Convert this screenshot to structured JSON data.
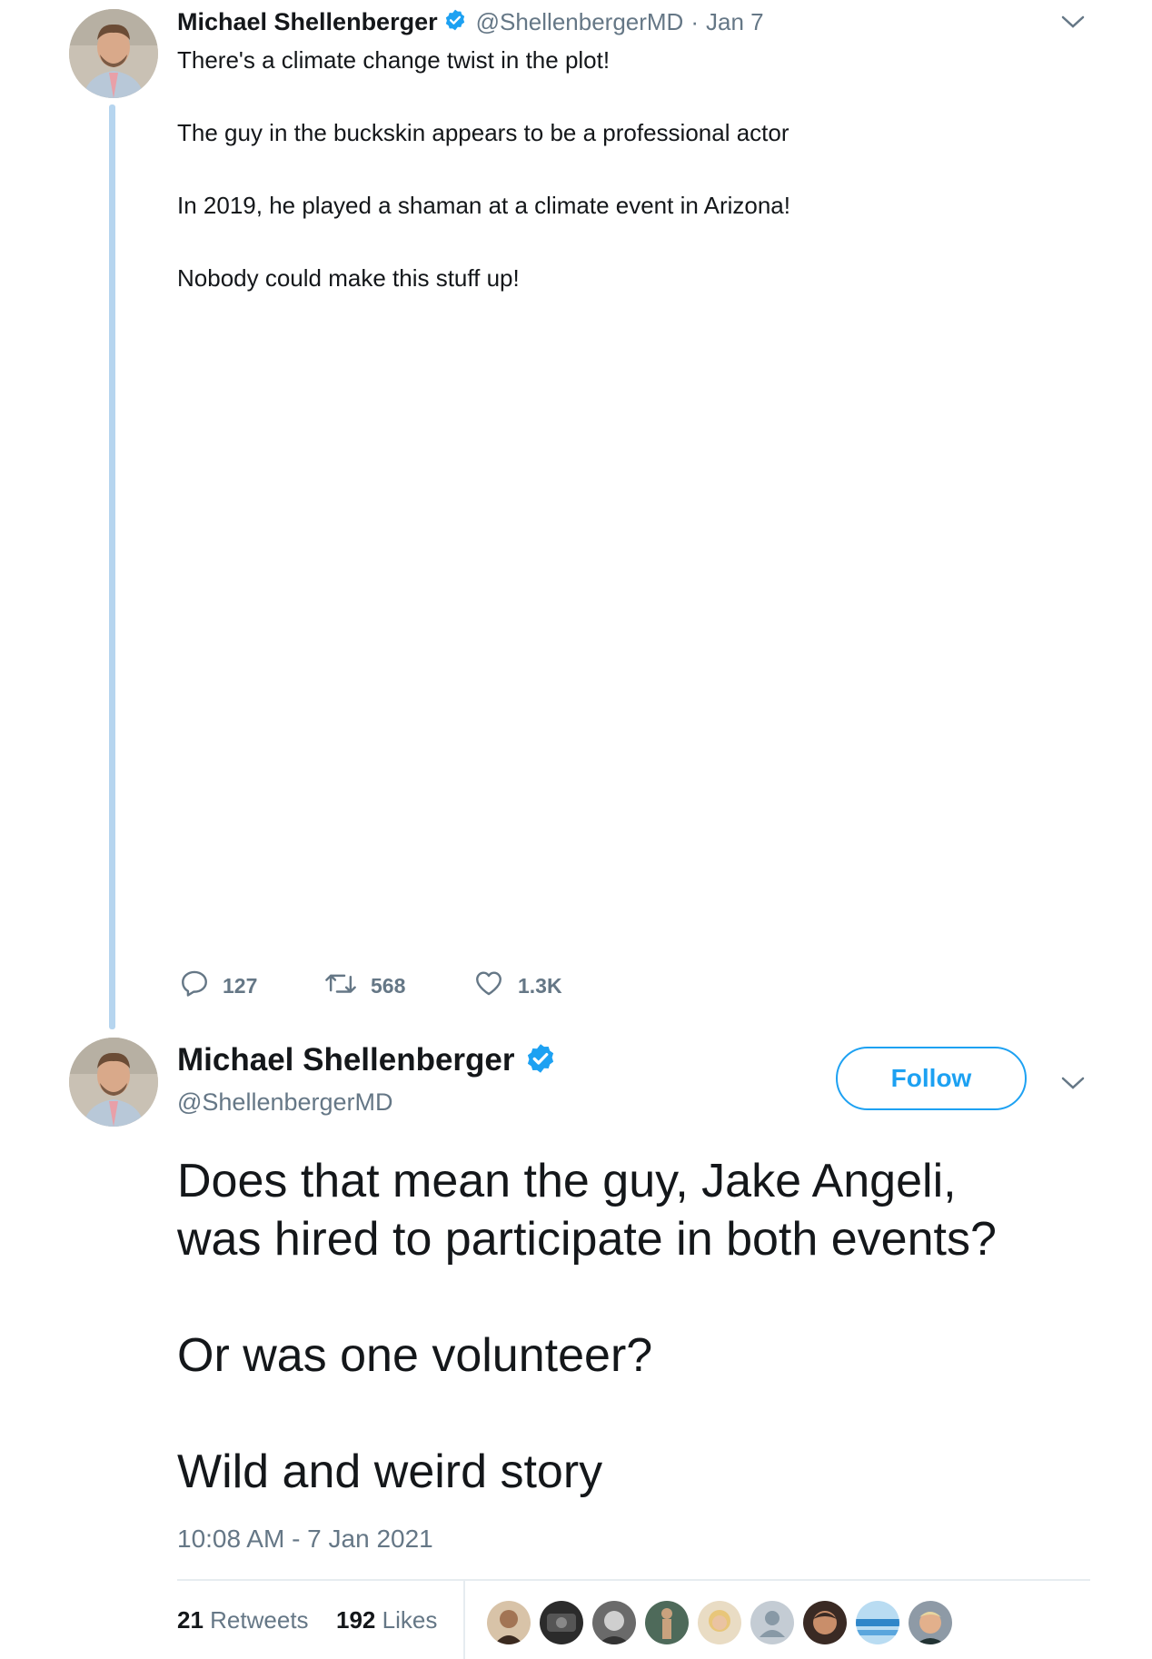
{
  "tweet1": {
    "author_name": "Michael Shellenberger",
    "handle": "@ShellenbergerMD",
    "date_sep": "·",
    "date": "Jan 7",
    "lines": [
      "There's a climate change twist in the plot!",
      "The guy in the buckskin appears to be a professional actor",
      "In 2019, he played a shaman at a climate event in Arizona!",
      "Nobody could make this stuff up!"
    ],
    "actions": {
      "replies": "127",
      "retweets": "568",
      "likes": "1.3K"
    }
  },
  "tweet2": {
    "author_name": "Michael Shellenberger",
    "handle": "@ShellenbergerMD",
    "follow_label": "Follow",
    "paragraphs": [
      "Does that mean the guy, Jake Angeli,\nwas hired to participate in both events?",
      "Or was one volunteer?",
      "Wild and weird story"
    ],
    "timestamp": "10:08 AM - 7 Jan 2021",
    "stats": {
      "retweets_count": "21",
      "retweets_label": "Retweets",
      "likes_count": "192",
      "likes_label": "Likes"
    },
    "likers": [
      "liker-avatar-1",
      "liker-avatar-2",
      "liker-avatar-3",
      "liker-avatar-4",
      "liker-avatar-5",
      "liker-avatar-6",
      "liker-avatar-7",
      "liker-avatar-8",
      "liker-avatar-9"
    ]
  },
  "colors": {
    "accent": "#1da1f2",
    "verified": "#1da1f2",
    "thread_line": "#b6d5ef",
    "muted": "#657786"
  }
}
